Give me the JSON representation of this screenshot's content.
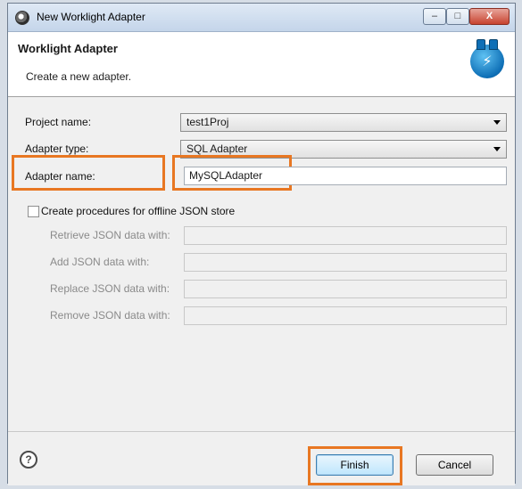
{
  "window": {
    "title": "New Worklight Adapter",
    "buttons": {
      "minimize": "–",
      "maximize": "□",
      "close": "X"
    }
  },
  "banner": {
    "title": "Worklight Adapter",
    "description": "Create a new adapter.",
    "icon": "adapter-plug-icon"
  },
  "form": {
    "project": {
      "label": "Project name:",
      "value": "test1Proj"
    },
    "adapter_type": {
      "label": "Adapter type:",
      "value": "SQL Adapter"
    },
    "adapter_name": {
      "label": "Adapter name:",
      "value": "MySQLAdapter"
    },
    "offline_checkbox": {
      "label": "Create procedures for offline JSON store",
      "checked": false
    },
    "json_fields": [
      {
        "label": "Retrieve JSON data with:",
        "value": ""
      },
      {
        "label": "Add JSON data with:",
        "value": ""
      },
      {
        "label": "Replace JSON data with:",
        "value": ""
      },
      {
        "label": "Remove JSON data with:",
        "value": ""
      }
    ]
  },
  "footer": {
    "help": "?",
    "finish": "Finish",
    "cancel": "Cancel"
  },
  "colors": {
    "highlight": "#e87722",
    "window_bg": "#f0f0f0"
  }
}
